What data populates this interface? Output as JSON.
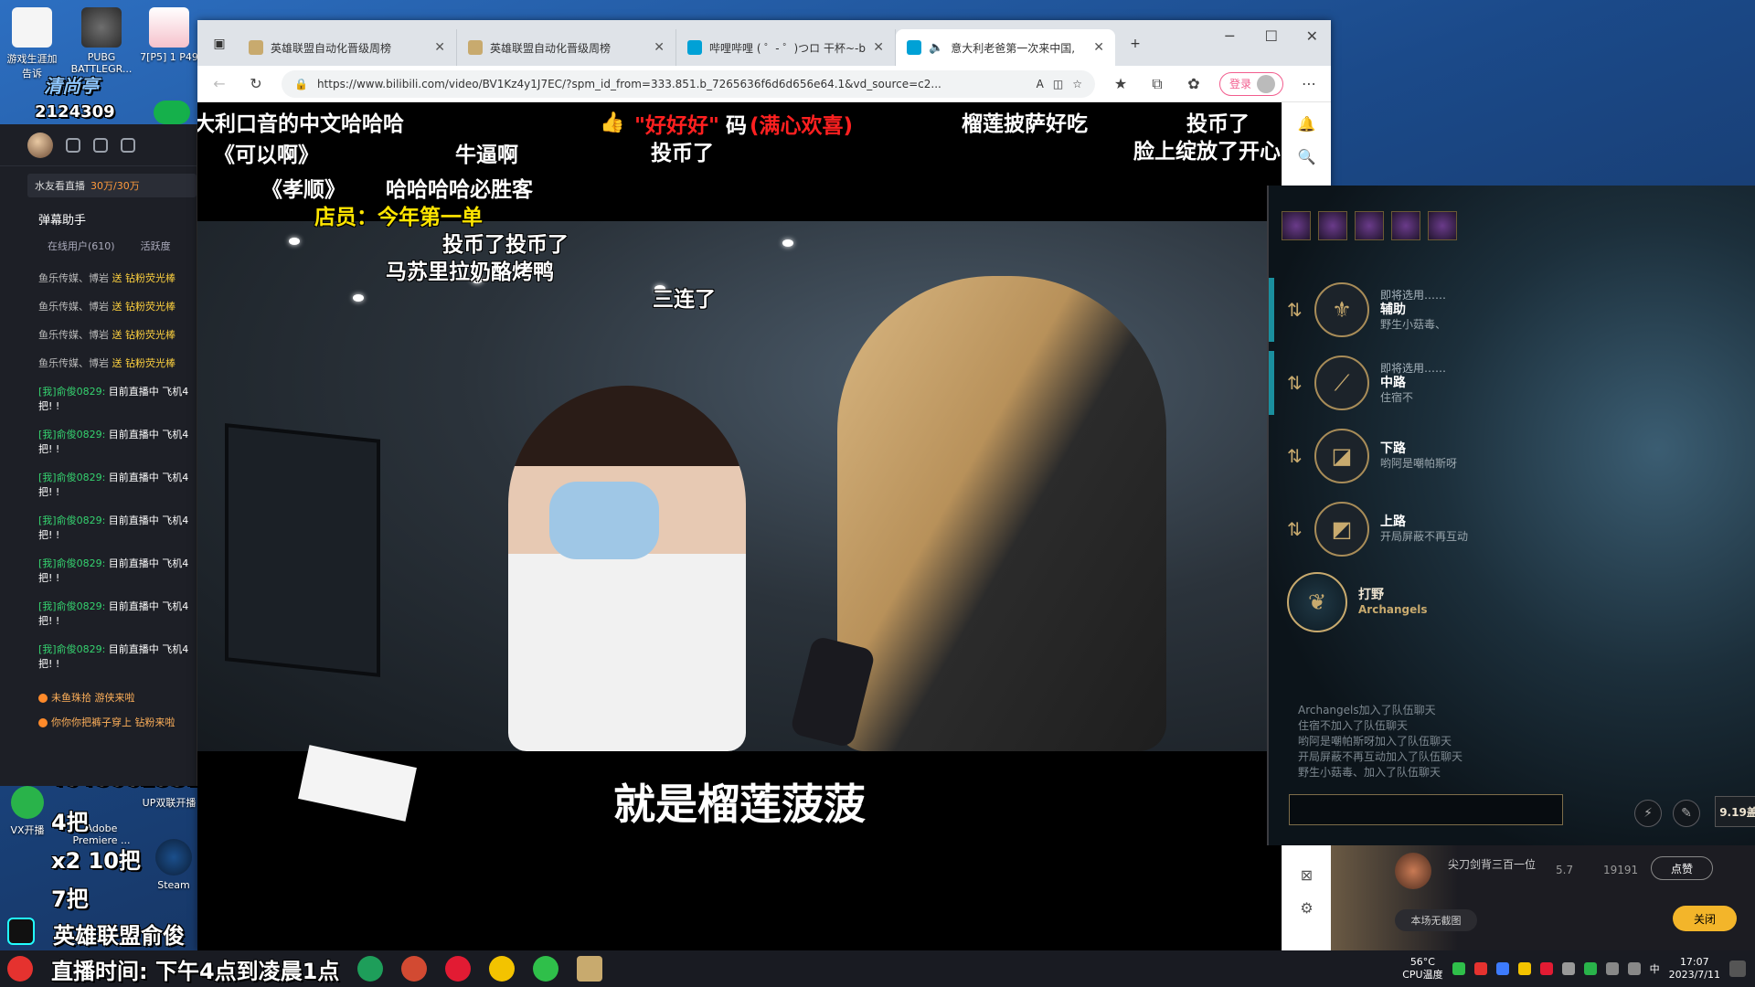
{
  "desktop": {
    "icons": [
      {
        "label": "游戏生涯加\n告诉"
      },
      {
        "label": "PUBG\nBATTLEGR..."
      },
      {
        "label": "7[P5] 1 P49"
      }
    ],
    "watermark": "清尚亭",
    "counter": "2124309",
    "bottom_icons": [
      {
        "label": "VX开播"
      },
      {
        "label": "Adobe\nPremiere ..."
      },
      {
        "label": "UP双联开播"
      },
      {
        "label": "Steam"
      }
    ],
    "overlay_qq": ":648062931",
    "overlay_4ba": "4把",
    "overlay_x2": "x2 10把",
    "overlay_7ba": "7把",
    "overlay_douyin": "英雄联盟俞俊",
    "overlay_time": "直播时间: 下午4点到凌晨1点"
  },
  "livetool": {
    "kids_label": "水友看直播",
    "kids_count": "30万/30万",
    "section": "弹幕助手",
    "tabs": [
      "在线用户(610)",
      "活跃度"
    ],
    "gifts": [
      {
        "who": "鱼乐传媒、博岩",
        "verb": "送",
        "gift": "钻粉荧光棒"
      },
      {
        "who": "鱼乐传媒、博岩",
        "verb": "送",
        "gift": "钻粉荧光棒"
      },
      {
        "who": "鱼乐传媒、博岩",
        "verb": "送",
        "gift": "钻粉荧光棒"
      },
      {
        "who": "鱼乐传媒、博岩",
        "verb": "送",
        "gift": "钻粉荧光棒"
      }
    ],
    "chats": [
      {
        "who": "[我]俞俊0829:",
        "text": "目前直播中 飞机4",
        "text2": "把! !"
      },
      {
        "who": "[我]俞俊0829:",
        "text": "目前直播中 飞机4",
        "text2": "把! !"
      },
      {
        "who": "[我]俞俊0829:",
        "text": "目前直播中 飞机4",
        "text2": "把! !"
      },
      {
        "who": "[我]俞俊0829:",
        "text": "目前直播中 飞机4",
        "text2": "把! !"
      },
      {
        "who": "[我]俞俊0829:",
        "text": "目前直播中 飞机4",
        "text2": "把! !"
      },
      {
        "who": "[我]俞俊0829:",
        "text": "目前直播中 飞机4",
        "text2": "把! !"
      },
      {
        "who": "[我]俞俊0829:",
        "text": "目前直播中 飞机4",
        "text2": "把! !"
      }
    ],
    "enters": [
      {
        "text": "未鱼珠拾 游侠来啦"
      },
      {
        "text": "你你你把裤子穿上 钻粉来啦"
      }
    ]
  },
  "browser": {
    "tabs": [
      {
        "title": "英雄联盟自动化晋级周榜",
        "active": false
      },
      {
        "title": "英雄联盟自动化晋级周榜",
        "active": false
      },
      {
        "title": "哔哩哔哩 ( ゜- ゜)つロ 干杯~-bilib",
        "active": false
      },
      {
        "title": "意大利老爸第一次来中国, ",
        "active": true
      }
    ],
    "new_tab": "+",
    "url": "https://www.bilibili.com/video/BV1Kz4y1J7EC/?spm_id_from=333.851.b_7265636f6d6d656e64.1&vd_source=c2...",
    "login_label": "登录"
  },
  "video": {
    "danmaku": [
      {
        "text": "大利口音的中文哈哈哈",
        "color": "#ffffff"
      },
      {
        "text": "《可以啊》",
        "color": "#ffffff"
      },
      {
        "text": "牛逼啊",
        "color": "#ffffff"
      },
      {
        "text": "《孝顺》",
        "color": "#ffffff"
      },
      {
        "text": "哈哈哈哈必胜客",
        "color": "#ffffff"
      },
      {
        "text": "店员：今年第一单",
        "color": "#ffe600"
      },
      {
        "text": "投币了投币了",
        "color": "#ffffff"
      },
      {
        "text": "马苏里拉奶酪烤鸭",
        "color": "#ffffff"
      },
      {
        "text": "三连了",
        "color": "#ffffff"
      },
      {
        "text": "\"好好好\"",
        "color": "#ff2020"
      },
      {
        "text": "码",
        "color": "#ffffff"
      },
      {
        "text": "(满心欢喜)",
        "color": "#ff2020"
      },
      {
        "text": "投币了",
        "color": "#ffffff"
      },
      {
        "text": "榴莲披萨好吃",
        "color": "#ffffff"
      },
      {
        "text": "投币了",
        "color": "#ffffff"
      },
      {
        "text": "脸上绽放了开心",
        "color": "#ffffff"
      }
    ],
    "subtitle": "就是榴莲菠菠"
  },
  "lol": {
    "slots": [
      {
        "pre": "即将选用……",
        "role": "辅助",
        "name": "野生小菇毒、",
        "icon": "support-icon"
      },
      {
        "pre": "即将选用……",
        "role": "中路",
        "name": "住宿不",
        "icon": "mid-icon"
      },
      {
        "pre": "",
        "role": "下路",
        "name": "哟阿是嘲帕斯呀",
        "icon": "bot-icon"
      },
      {
        "pre": "",
        "role": "上路",
        "name": "开局屏蔽不再互动",
        "icon": "top-icon"
      },
      {
        "pre": "",
        "role": "打野",
        "name": "Archangels",
        "icon": "jungle-icon"
      }
    ],
    "chat": [
      "Archangels加入了队伍聊天",
      "住宿不加入了队伍聊天",
      "哟阿是嘲帕斯呀加入了队伍聊天",
      "开局屏蔽不再互动加入了队伍聊天",
      "野生小菇毒、加入了队伍聊天"
    ],
    "badge": "9.19盖"
  },
  "friend_panel": {
    "name": "尖刀剑背三百一位",
    "level": "5.7",
    "points": "19191",
    "btn_like": "点赞",
    "no_capture": "本场无截图",
    "btn_close": "关闭"
  },
  "taskbar": {
    "temp": "56°C",
    "temp_label": "CPU温度",
    "time": "17:07",
    "date": "2023/7/11",
    "ime": "中"
  }
}
